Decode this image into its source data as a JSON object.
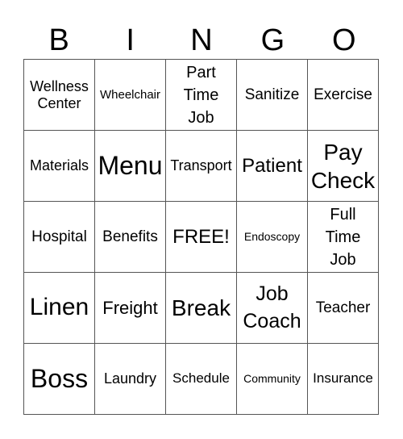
{
  "header": [
    "B",
    "I",
    "N",
    "G",
    "O"
  ],
  "cells": [
    [
      "Wellness\nCenter",
      "Wheelchair",
      "Part\nTime\nJob",
      "Sanitize",
      "Exercise"
    ],
    [
      "Materials",
      "Menu",
      "Transport",
      "Patient",
      "Pay\nCheck"
    ],
    [
      "Hospital",
      "Benefits",
      "FREE!",
      "Endoscopy",
      "Full\nTime\nJob"
    ],
    [
      "Linen",
      "Freight",
      "Break",
      "Job\nCoach",
      "Teacher"
    ],
    [
      "Boss",
      "Laundry",
      "Schedule",
      "Community",
      "Insurance"
    ]
  ]
}
